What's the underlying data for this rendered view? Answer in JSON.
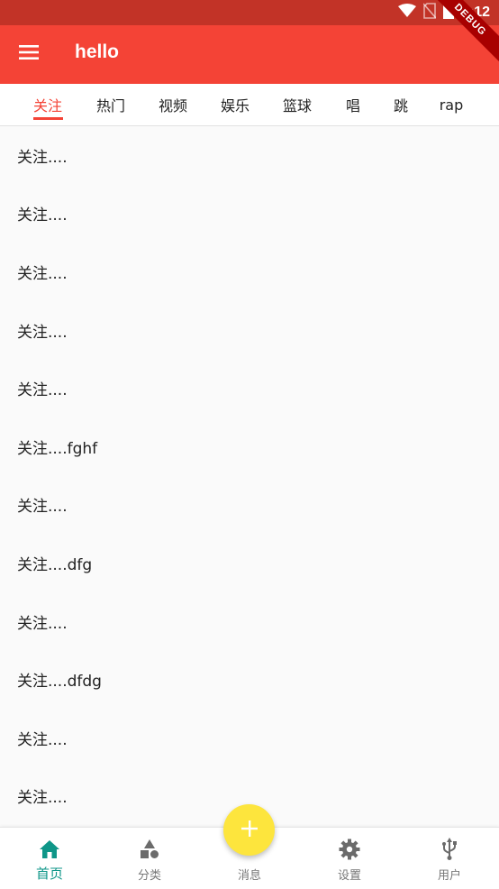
{
  "status_bar": {
    "time": "7:12",
    "color": "#c23327"
  },
  "debug_banner": {
    "label": "DEBUG"
  },
  "app_bar": {
    "title": "hello",
    "color": "#f44336",
    "menu_icon": "menu-icon"
  },
  "tabs": [
    {
      "label": "关注",
      "active": true
    },
    {
      "label": "热门"
    },
    {
      "label": "视频"
    },
    {
      "label": "娱乐"
    },
    {
      "label": "篮球"
    },
    {
      "label": "唱"
    },
    {
      "label": "跳"
    },
    {
      "label": "rap"
    }
  ],
  "list": [
    {
      "text": "关注...."
    },
    {
      "text": "关注...."
    },
    {
      "text": "关注...."
    },
    {
      "text": "关注...."
    },
    {
      "text": "关注...."
    },
    {
      "text": "关注....fghf"
    },
    {
      "text": "关注...."
    },
    {
      "text": "关注....dfg"
    },
    {
      "text": "关注...."
    },
    {
      "text": "关注....dfdg"
    },
    {
      "text": "关注...."
    },
    {
      "text": "关注...."
    }
  ],
  "fab": {
    "icon": "add-icon",
    "color": "#fde53d"
  },
  "bottom_nav": [
    {
      "label": "首页",
      "icon": "home-icon",
      "active": true
    },
    {
      "label": "分类",
      "icon": "category-icon"
    },
    {
      "label": "消息",
      "icon": ""
    },
    {
      "label": "设置",
      "icon": "gear-icon"
    },
    {
      "label": "用户",
      "icon": "usb-icon"
    }
  ],
  "colors": {
    "accent": "#f44336",
    "nav_active": "#0e9688",
    "nav_inactive": "#777777"
  }
}
